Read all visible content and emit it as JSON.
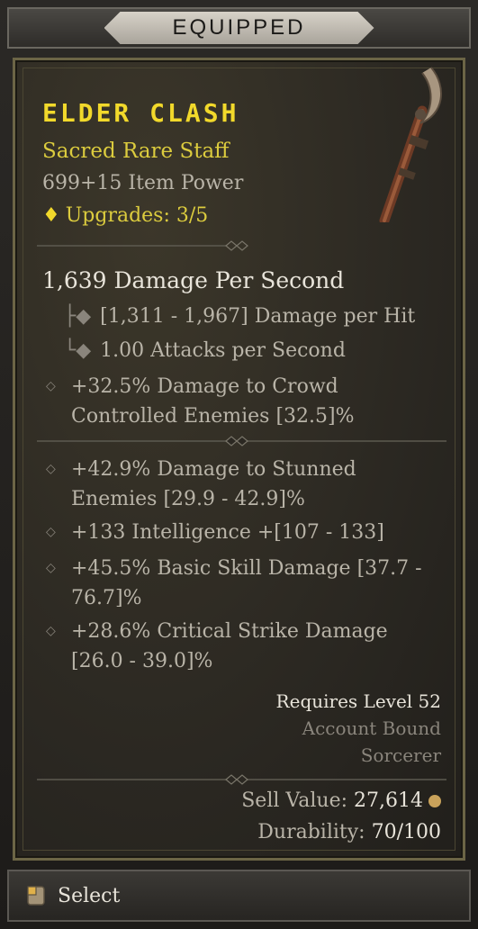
{
  "header": {
    "title": "EQUIPPED"
  },
  "item": {
    "name": "ELDER CLASH",
    "type": "Sacred Rare Staff",
    "power": "699+15 Item Power",
    "upgrades": "Upgrades: 3/5"
  },
  "stats": {
    "dps": "1,639 Damage Per Second",
    "per_hit": "[1,311 - 1,967] Damage per Hit",
    "attacks": "1.00 Attacks per Second",
    "implicit": "+32.5% Damage to Crowd Controlled Enemies [32.5]%"
  },
  "affixes": [
    "+42.9% Damage to Stunned Enemies [29.9 - 42.9]%",
    "+133 Intelligence +[107 - 133]",
    "+45.5% Basic Skill Damage [37.7 - 76.7]%",
    "+28.6% Critical Strike Damage [26.0 - 39.0]%"
  ],
  "requirements": {
    "level": "Requires Level 52",
    "bound": "Account Bound",
    "class": "Sorcerer"
  },
  "sell": {
    "label": "Sell Value: ",
    "value": "27,614"
  },
  "durability": {
    "label": "Durability: ",
    "value": "70/100"
  },
  "footer": {
    "select_label": "Select"
  },
  "icons": {
    "upgrade": "diamond-icon",
    "bullet": "diamond-bullet-icon",
    "coin": "gold-coin-icon",
    "select": "mouse-button-icon",
    "item": "staff-icon"
  },
  "colors": {
    "rare": "#f2d92b",
    "affix_text": "#b9b4a8",
    "bright_text": "#e8e4da",
    "muted": "#8a857c",
    "card_border": "#6c6546"
  }
}
